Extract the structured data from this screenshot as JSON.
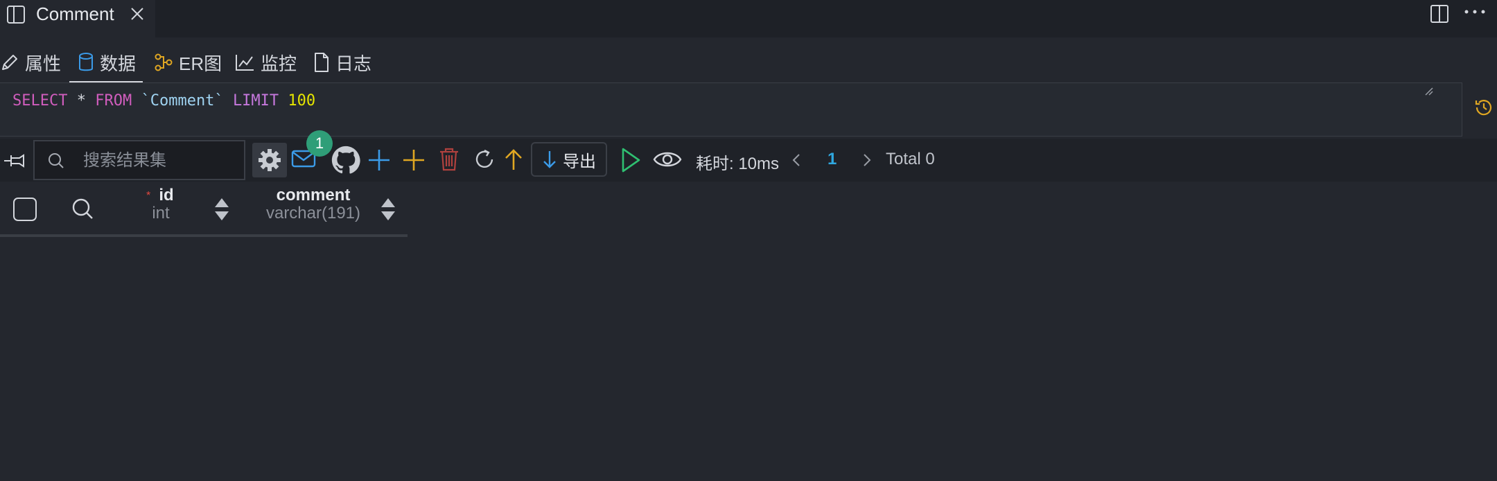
{
  "tab": {
    "title": "Comment"
  },
  "subtabs": [
    {
      "label": "属性"
    },
    {
      "label": "数据"
    },
    {
      "label": "ER图"
    },
    {
      "label": "监控"
    },
    {
      "label": "日志"
    }
  ],
  "sql": {
    "select": "SELECT",
    "star": "*",
    "from": "FROM",
    "table": "`Comment`",
    "limit": "LIMIT",
    "limit_value": "100"
  },
  "toolbar": {
    "search_placeholder": "搜索结果集",
    "mail_badge": "1",
    "export_label": "导出",
    "elapsed": "耗时: 10ms",
    "page": "1",
    "total": "Total 0"
  },
  "columns": [
    {
      "name": "id",
      "type": "int",
      "required": "*"
    },
    {
      "name": "comment",
      "type": "varchar(191)"
    }
  ],
  "colors": {
    "background": "#24272e",
    "accent_blue": "#2f9e78",
    "keyword": "#c678dd",
    "number": "#e5e500",
    "add_yellow": "#e0a722",
    "delete_red": "#b0413e",
    "run_green": "#2fbf71"
  }
}
